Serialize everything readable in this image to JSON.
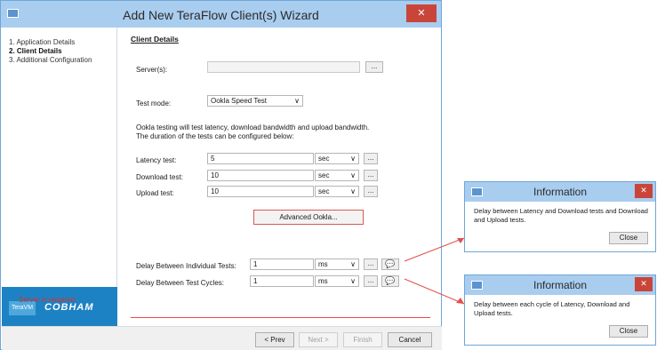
{
  "wizard": {
    "title": "Add New TeraFlow Client(s) Wizard",
    "close_label": "✕",
    "steps": [
      {
        "label": "1. Application Details"
      },
      {
        "label": "2. Client Details"
      },
      {
        "label": "3. Additional Configuration"
      }
    ],
    "logo_left": "TeraVM",
    "logo_right": "COBHAM",
    "section_title": "Client Details",
    "server": {
      "label": "Server(s):",
      "value": "",
      "browse_label": "..."
    },
    "test_mode": {
      "label": "Test mode:",
      "value": "Ookla Speed Test",
      "arrow": "∨"
    },
    "description_line1": "Ookla testing will test latency, download bandwidth and upload bandwidth.",
    "description_line2": "The duration of the tests can be configured below:",
    "tests": [
      {
        "label": "Latency test:",
        "value": "5",
        "unit": "sec"
      },
      {
        "label": "Download test:",
        "value": "10",
        "unit": "sec"
      },
      {
        "label": "Upload test:",
        "value": "10",
        "unit": "sec"
      }
    ],
    "advanced_label": "Advanced Ookla...",
    "delays": [
      {
        "label": "Delay Between Individual Tests:",
        "value": "1",
        "unit": "ms"
      },
      {
        "label": "Delay Between Test Cycles:",
        "value": "1",
        "unit": "ms"
      }
    ],
    "ellipsis": "...",
    "arrow": "∨",
    "bubble_icon": "💬",
    "error_text": "Server is required.",
    "buttons": {
      "prev": "< Prev",
      "next": "Next >",
      "finish": "Finish",
      "cancel": "Cancel"
    }
  },
  "info_dialogs": [
    {
      "title": "Information",
      "message": "Delay between Latency and Download tests and Download and Upload tests.",
      "close_label": "Close",
      "close_x": "✕"
    },
    {
      "title": "Information",
      "message": "Delay  between each cycle of Latency, Download and Upload tests.",
      "close_label": "Close",
      "close_x": "✕"
    }
  ],
  "colors": {
    "accent": "#a9cdef",
    "error": "#d6312b",
    "close": "#c9453a",
    "brand": "#1d82c4"
  }
}
